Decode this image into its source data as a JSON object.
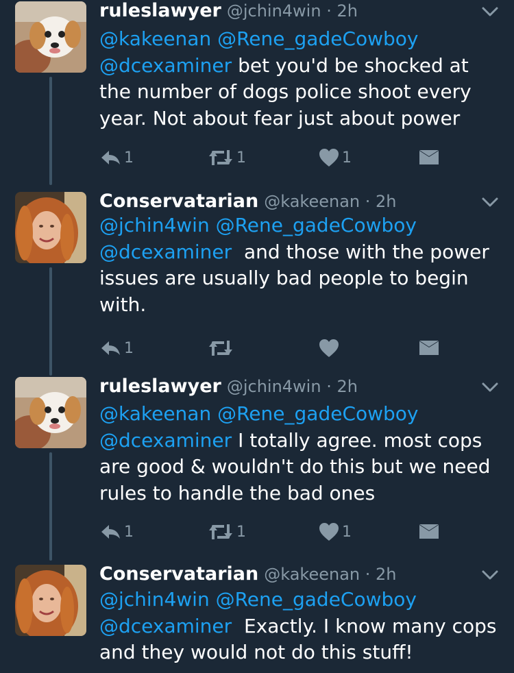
{
  "tweets": [
    {
      "name": "ruleslawyer",
      "handle": "@jchin4win",
      "time": "2h",
      "mentions": [
        "@kakeenan",
        "@Rene_gadeCowboy",
        "@dcexaminer"
      ],
      "text_lines": [
        "bet you'd be shocked at",
        "the number of dogs police shoot every",
        "year. Not about fear just about power"
      ],
      "reply_count": "1",
      "retweet_count": "1",
      "like_count": "1"
    },
    {
      "name": "Conservatarian",
      "handle": "@kakeenan",
      "time": "2h",
      "mentions": [
        "@jchin4win",
        "@Rene_gadeCowboy",
        "@dcexaminer"
      ],
      "text_lines": [
        "and those with the power",
        "issues are usually bad people to begin",
        "with."
      ],
      "reply_count": "1",
      "retweet_count": "",
      "like_count": ""
    },
    {
      "name": "ruleslawyer",
      "handle": "@jchin4win",
      "time": "2h",
      "mentions": [
        "@kakeenan",
        "@Rene_gadeCowboy",
        "@dcexaminer"
      ],
      "text_lines": [
        "I totally agree. most cops",
        "are good & wouldn't do this but we need",
        "rules to handle the bad ones"
      ],
      "reply_count": "1",
      "retweet_count": "1",
      "like_count": "1"
    },
    {
      "name": "Conservatarian",
      "handle": "@kakeenan",
      "time": "2h",
      "mentions": [
        "@jchin4win",
        "@Rene_gadeCowboy",
        "@dcexaminer"
      ],
      "text_lines": [
        "Exactly. I know many cops",
        "and they would not do this stuff!"
      ]
    }
  ],
  "icons": {
    "reply": "reply-icon",
    "retweet": "retweet-icon",
    "like": "heart-icon",
    "dm": "envelope-icon",
    "menu": "chevron-down-icon"
  },
  "colors": {
    "background": "#1b2836",
    "mention": "#1da1f2",
    "muted": "#8899a6",
    "text": "#ffffff"
  }
}
